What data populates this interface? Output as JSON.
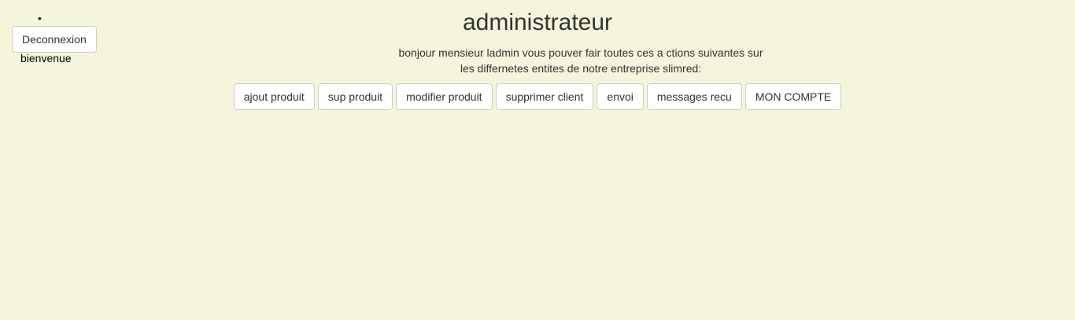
{
  "sidebar": {
    "bullet": "•",
    "logout_label": "Deconnexion",
    "welcome": "bienvenue"
  },
  "main": {
    "title": "administrateur",
    "intro_line1": "bonjour mensieur ladmin vous pouver fair toutes ces a ctions suivantes sur",
    "intro_line2": "les differnetes entites de notre entreprise slimred:",
    "actions": [
      {
        "label": "ajout produit"
      },
      {
        "label": "sup produit"
      },
      {
        "label": "modifier produit"
      },
      {
        "label": "supprimer client"
      },
      {
        "label": "envoi"
      },
      {
        "label": "messages recu"
      },
      {
        "label": "MON COMPTE"
      }
    ]
  },
  "colors": {
    "background": "#f5f5dc",
    "button_bg": "#ffffff",
    "button_border": "#cccccc",
    "text": "#333333"
  }
}
